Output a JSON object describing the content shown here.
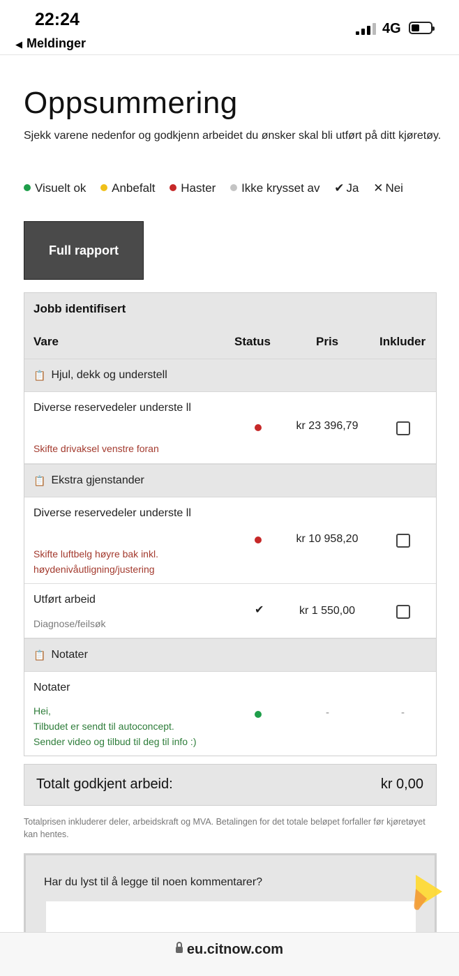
{
  "status_bar": {
    "time": "22:24",
    "back_label": "Meldinger",
    "network": "4G"
  },
  "page": {
    "title": "Oppsummering",
    "intro": "Sjekk varene nedenfor og godkjenn arbeidet du ønsker skal bli utført på ditt kjøretøy.",
    "legend": [
      {
        "label": "Visuelt ok",
        "color": "#1e9e4a"
      },
      {
        "label": "Anbefalt",
        "color": "#f0c01a"
      },
      {
        "label": "Haster",
        "color": "#c62828"
      },
      {
        "label": "Ikke krysset av",
        "color": "#c4c4c4"
      },
      {
        "label": "Ja",
        "icon": "check-icon"
      },
      {
        "label": "Nei",
        "icon": "cross-icon"
      }
    ],
    "full_report_label": "Full rapport"
  },
  "table": {
    "title": "Jobb identifisert",
    "columns": [
      "Vare",
      "Status",
      "Pris",
      "Inkluder"
    ],
    "groups": [
      {
        "name": "Hjul, dekk og understell",
        "icon": "clipboard-icon",
        "items": [
          {
            "name": "Diverse reservedeler underste ll",
            "detail": "Skifte drivaksel venstre foran",
            "status": "haster",
            "price": "kr 23 396,79",
            "include": false
          }
        ]
      },
      {
        "name": "Ekstra gjenstander",
        "icon": "clipboard-icon",
        "items": [
          {
            "name": "Diverse reservedeler underste ll",
            "detail": "Skifte luftbelg høyre bak inkl. høydenivåutligning/justering",
            "status": "haster",
            "price": "kr 10 958,20",
            "include": false
          },
          {
            "name": "Utført arbeid",
            "detail": "Diagnose/feilsøk",
            "status": "ja",
            "price": "kr 1 550,00",
            "include": false
          }
        ]
      },
      {
        "name": "Notater",
        "icon": "clipboard-icon",
        "items": [
          {
            "name": "Notater",
            "detail_lines": [
              "Hei,",
              "Tilbudet er sendt til autoconcept.",
              "Sender video og tilbud til deg til info :)"
            ],
            "status": "visuelt-ok",
            "price": "-",
            "include": "-"
          }
        ]
      }
    ]
  },
  "total": {
    "label": "Totalt godkjent arbeid:",
    "value": "kr 0,00"
  },
  "footnote": "Totalprisen inkluderer deler, arbeidskraft og MVA. Betalingen for det totale beløpet forfaller før kjøretøyet kan hentes.",
  "comments": {
    "prompt": "Har du lyst til å legge til noen kommentarer?"
  },
  "url_bar": {
    "url": "eu.citnow.com"
  },
  "colors": {
    "urgent_text": "#a33a2e",
    "note_text": "#2e7d3a",
    "muted_text": "#7a7a7a",
    "button_bg": "#4a4a4a"
  }
}
